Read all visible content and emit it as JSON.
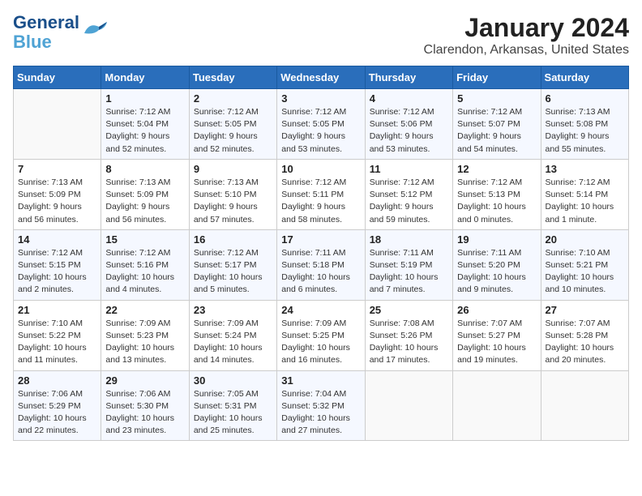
{
  "header": {
    "logo_line1": "General",
    "logo_line2": "Blue",
    "month": "January 2024",
    "location": "Clarendon, Arkansas, United States"
  },
  "weekdays": [
    "Sunday",
    "Monday",
    "Tuesday",
    "Wednesday",
    "Thursday",
    "Friday",
    "Saturday"
  ],
  "weeks": [
    [
      {
        "day": "",
        "sunrise": "",
        "sunset": "",
        "daylight": ""
      },
      {
        "day": "1",
        "sunrise": "Sunrise: 7:12 AM",
        "sunset": "Sunset: 5:04 PM",
        "daylight": "Daylight: 9 hours and 52 minutes."
      },
      {
        "day": "2",
        "sunrise": "Sunrise: 7:12 AM",
        "sunset": "Sunset: 5:05 PM",
        "daylight": "Daylight: 9 hours and 52 minutes."
      },
      {
        "day": "3",
        "sunrise": "Sunrise: 7:12 AM",
        "sunset": "Sunset: 5:05 PM",
        "daylight": "Daylight: 9 hours and 53 minutes."
      },
      {
        "day": "4",
        "sunrise": "Sunrise: 7:12 AM",
        "sunset": "Sunset: 5:06 PM",
        "daylight": "Daylight: 9 hours and 53 minutes."
      },
      {
        "day": "5",
        "sunrise": "Sunrise: 7:12 AM",
        "sunset": "Sunset: 5:07 PM",
        "daylight": "Daylight: 9 hours and 54 minutes."
      },
      {
        "day": "6",
        "sunrise": "Sunrise: 7:13 AM",
        "sunset": "Sunset: 5:08 PM",
        "daylight": "Daylight: 9 hours and 55 minutes."
      }
    ],
    [
      {
        "day": "7",
        "sunrise": "Sunrise: 7:13 AM",
        "sunset": "Sunset: 5:09 PM",
        "daylight": "Daylight: 9 hours and 56 minutes."
      },
      {
        "day": "8",
        "sunrise": "Sunrise: 7:13 AM",
        "sunset": "Sunset: 5:09 PM",
        "daylight": "Daylight: 9 hours and 56 minutes."
      },
      {
        "day": "9",
        "sunrise": "Sunrise: 7:13 AM",
        "sunset": "Sunset: 5:10 PM",
        "daylight": "Daylight: 9 hours and 57 minutes."
      },
      {
        "day": "10",
        "sunrise": "Sunrise: 7:12 AM",
        "sunset": "Sunset: 5:11 PM",
        "daylight": "Daylight: 9 hours and 58 minutes."
      },
      {
        "day": "11",
        "sunrise": "Sunrise: 7:12 AM",
        "sunset": "Sunset: 5:12 PM",
        "daylight": "Daylight: 9 hours and 59 minutes."
      },
      {
        "day": "12",
        "sunrise": "Sunrise: 7:12 AM",
        "sunset": "Sunset: 5:13 PM",
        "daylight": "Daylight: 10 hours and 0 minutes."
      },
      {
        "day": "13",
        "sunrise": "Sunrise: 7:12 AM",
        "sunset": "Sunset: 5:14 PM",
        "daylight": "Daylight: 10 hours and 1 minute."
      }
    ],
    [
      {
        "day": "14",
        "sunrise": "Sunrise: 7:12 AM",
        "sunset": "Sunset: 5:15 PM",
        "daylight": "Daylight: 10 hours and 2 minutes."
      },
      {
        "day": "15",
        "sunrise": "Sunrise: 7:12 AM",
        "sunset": "Sunset: 5:16 PM",
        "daylight": "Daylight: 10 hours and 4 minutes."
      },
      {
        "day": "16",
        "sunrise": "Sunrise: 7:12 AM",
        "sunset": "Sunset: 5:17 PM",
        "daylight": "Daylight: 10 hours and 5 minutes."
      },
      {
        "day": "17",
        "sunrise": "Sunrise: 7:11 AM",
        "sunset": "Sunset: 5:18 PM",
        "daylight": "Daylight: 10 hours and 6 minutes."
      },
      {
        "day": "18",
        "sunrise": "Sunrise: 7:11 AM",
        "sunset": "Sunset: 5:19 PM",
        "daylight": "Daylight: 10 hours and 7 minutes."
      },
      {
        "day": "19",
        "sunrise": "Sunrise: 7:11 AM",
        "sunset": "Sunset: 5:20 PM",
        "daylight": "Daylight: 10 hours and 9 minutes."
      },
      {
        "day": "20",
        "sunrise": "Sunrise: 7:10 AM",
        "sunset": "Sunset: 5:21 PM",
        "daylight": "Daylight: 10 hours and 10 minutes."
      }
    ],
    [
      {
        "day": "21",
        "sunrise": "Sunrise: 7:10 AM",
        "sunset": "Sunset: 5:22 PM",
        "daylight": "Daylight: 10 hours and 11 minutes."
      },
      {
        "day": "22",
        "sunrise": "Sunrise: 7:09 AM",
        "sunset": "Sunset: 5:23 PM",
        "daylight": "Daylight: 10 hours and 13 minutes."
      },
      {
        "day": "23",
        "sunrise": "Sunrise: 7:09 AM",
        "sunset": "Sunset: 5:24 PM",
        "daylight": "Daylight: 10 hours and 14 minutes."
      },
      {
        "day": "24",
        "sunrise": "Sunrise: 7:09 AM",
        "sunset": "Sunset: 5:25 PM",
        "daylight": "Daylight: 10 hours and 16 minutes."
      },
      {
        "day": "25",
        "sunrise": "Sunrise: 7:08 AM",
        "sunset": "Sunset: 5:26 PM",
        "daylight": "Daylight: 10 hours and 17 minutes."
      },
      {
        "day": "26",
        "sunrise": "Sunrise: 7:07 AM",
        "sunset": "Sunset: 5:27 PM",
        "daylight": "Daylight: 10 hours and 19 minutes."
      },
      {
        "day": "27",
        "sunrise": "Sunrise: 7:07 AM",
        "sunset": "Sunset: 5:28 PM",
        "daylight": "Daylight: 10 hours and 20 minutes."
      }
    ],
    [
      {
        "day": "28",
        "sunrise": "Sunrise: 7:06 AM",
        "sunset": "Sunset: 5:29 PM",
        "daylight": "Daylight: 10 hours and 22 minutes."
      },
      {
        "day": "29",
        "sunrise": "Sunrise: 7:06 AM",
        "sunset": "Sunset: 5:30 PM",
        "daylight": "Daylight: 10 hours and 23 minutes."
      },
      {
        "day": "30",
        "sunrise": "Sunrise: 7:05 AM",
        "sunset": "Sunset: 5:31 PM",
        "daylight": "Daylight: 10 hours and 25 minutes."
      },
      {
        "day": "31",
        "sunrise": "Sunrise: 7:04 AM",
        "sunset": "Sunset: 5:32 PM",
        "daylight": "Daylight: 10 hours and 27 minutes."
      },
      {
        "day": "",
        "sunrise": "",
        "sunset": "",
        "daylight": ""
      },
      {
        "day": "",
        "sunrise": "",
        "sunset": "",
        "daylight": ""
      },
      {
        "day": "",
        "sunrise": "",
        "sunset": "",
        "daylight": ""
      }
    ]
  ]
}
